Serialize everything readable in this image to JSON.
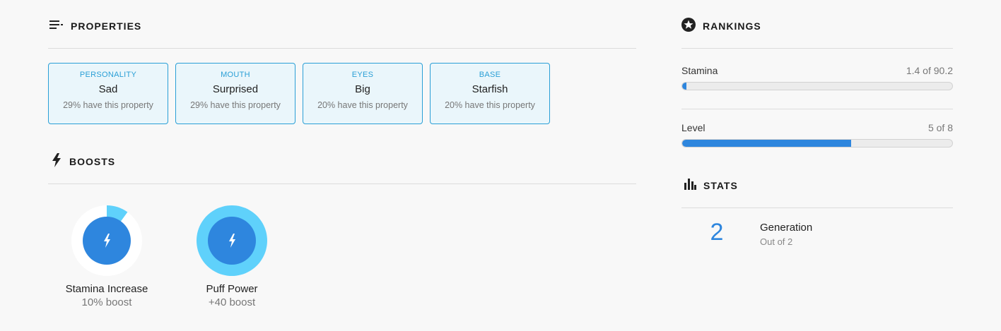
{
  "properties": {
    "title": "PROPERTIES",
    "icon": "list-icon",
    "items": [
      {
        "type": "PERSONALITY",
        "value": "Sad",
        "trait": "29% have this property"
      },
      {
        "type": "MOUTH",
        "value": "Surprised",
        "trait": "29% have this property"
      },
      {
        "type": "EYES",
        "value": "Big",
        "trait": "20% have this property"
      },
      {
        "type": "BASE",
        "value": "Starfish",
        "trait": "20% have this property"
      }
    ]
  },
  "boosts": {
    "title": "BOOSTS",
    "icon": "lightning-icon",
    "items": [
      {
        "name": "Stamina Increase",
        "value": "10% boost",
        "fill_fraction": 0.1
      },
      {
        "name": "Puff Power",
        "value": "+40 boost",
        "fill_fraction": 1.0
      }
    ]
  },
  "rankings": {
    "title": "RANKINGS",
    "icon": "star-circle-icon",
    "items": [
      {
        "label": "Stamina",
        "value": "1.4 of 90.2",
        "fill_fraction": 0.016
      },
      {
        "label": "Level",
        "value": "5 of 8",
        "fill_fraction": 0.625
      }
    ]
  },
  "stats": {
    "title": "STATS",
    "icon": "bar-chart-icon",
    "items": [
      {
        "number": "2",
        "label": "Generation",
        "sub": "Out of 2"
      }
    ]
  },
  "colors": {
    "accent_blue": "#2e86de",
    "light_blue": "#5fd1fb",
    "card_border": "#2a9fd6",
    "card_bg": "#eaf6fb"
  }
}
